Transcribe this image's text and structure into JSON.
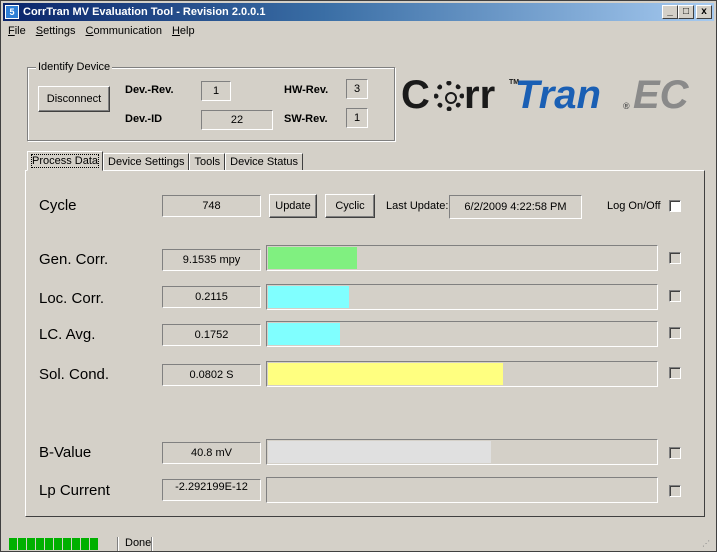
{
  "window": {
    "title": "CorrTran MV Evaluation Tool - Revision 2.0.0.1",
    "icon_text": "5",
    "buttons": {
      "minimize": "_",
      "maximize": "□",
      "close": "x"
    }
  },
  "menu": [
    {
      "label": "File",
      "key": "F",
      "rest": "ile"
    },
    {
      "label": "Settings",
      "key": "S",
      "rest": "ettings"
    },
    {
      "label": "Communication",
      "key": "C",
      "rest": "ommunication"
    },
    {
      "label": "Help",
      "key": "H",
      "rest": "elp"
    }
  ],
  "identify": {
    "legend": "Identify Device",
    "disconnect_label": "Disconnect",
    "dev_rev_label": "Dev.-Rev.",
    "dev_rev_value": "1",
    "dev_id_label": "Dev.-ID",
    "dev_id_value": "22",
    "hw_rev_label": "HW-Rev.",
    "hw_rev_value": "3",
    "sw_rev_label": "SW-Rev.",
    "sw_rev_value": "1"
  },
  "logo": {
    "text": "CorrTran.EC",
    "c": "C",
    "rr": "rr",
    "tm": "TM",
    "tran": "Tran",
    "reg": "®",
    "ec": "EC"
  },
  "tabs": [
    "Process Data",
    "Device Settings",
    "Tools",
    "Device Status"
  ],
  "active_tab": "Process Data",
  "cycle": {
    "label": "Cycle",
    "value": "748",
    "update_label": "Update",
    "cyclic_label": "Cyclic",
    "last_update_label": "Last Update:",
    "last_update_value": "6/2/2009 4:22:58 PM",
    "log_label": "Log On/Off",
    "log_checked": false
  },
  "measurements": [
    {
      "label": "Gen. Corr.",
      "value": "9.1535 mpy",
      "fill": 0.23,
      "color": "#80f080"
    },
    {
      "label": "Loc. Corr.",
      "value": "0.2115",
      "fill": 0.21,
      "color": "#80ffff"
    },
    {
      "label": "LC. Avg.",
      "value": "0.1752",
      "fill": 0.185,
      "color": "#80ffff"
    },
    {
      "label": "Sol. Cond.",
      "value": "0.0802 S",
      "fill": 0.605,
      "color": "#ffff80"
    },
    {
      "label": "B-Value",
      "value": "40.8 mV",
      "fill": 0.575,
      "color": "#e0e0e0"
    },
    {
      "label": "Lp Current",
      "value": "-2.292199E-12",
      "fill": 0,
      "color": "#d4d0c8"
    }
  ],
  "status": {
    "progress_blocks": 10,
    "text": "Done",
    "progress_color": "#00b000"
  }
}
